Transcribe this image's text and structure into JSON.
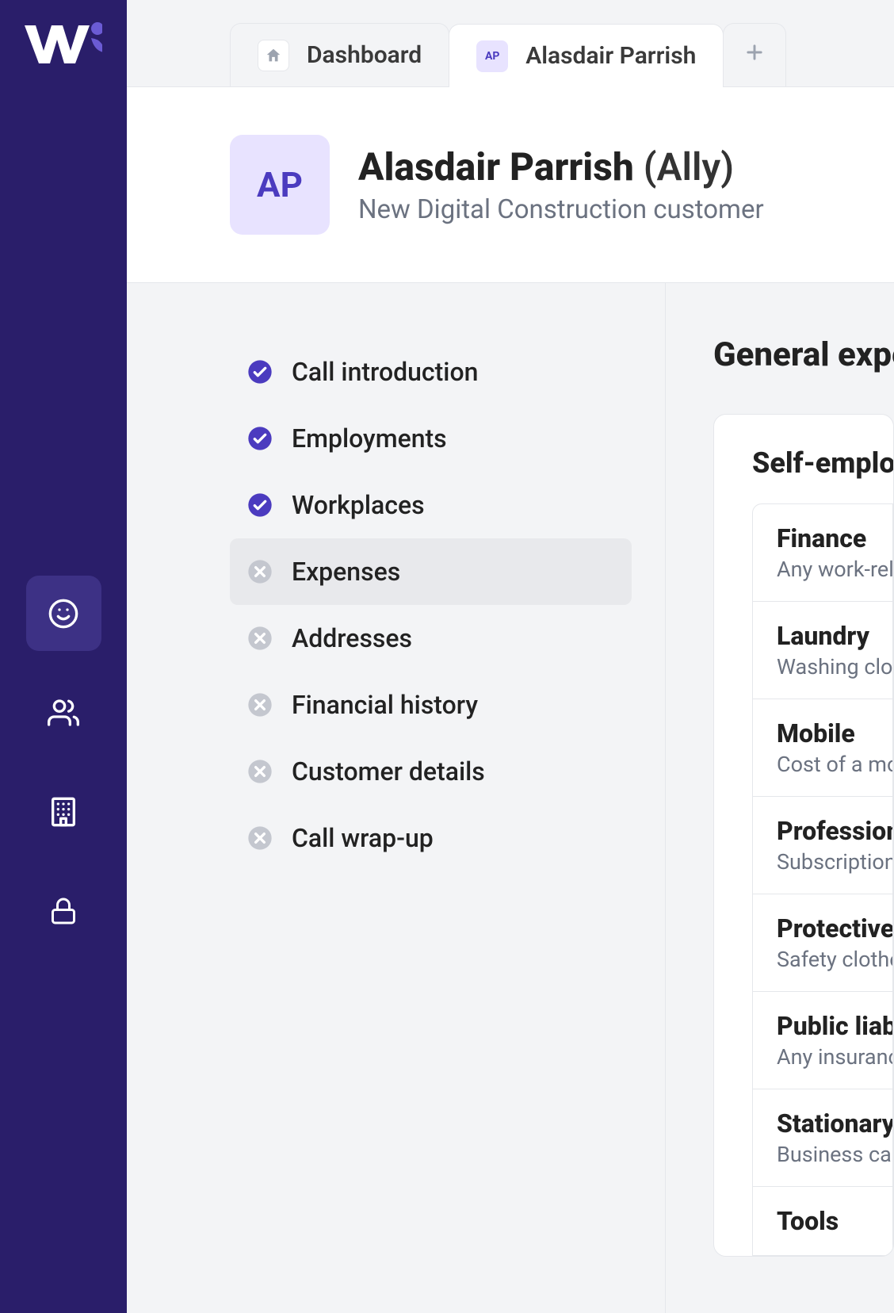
{
  "rail": {
    "items": [
      {
        "name": "smile",
        "active": true
      },
      {
        "name": "people",
        "active": false
      },
      {
        "name": "building",
        "active": false
      },
      {
        "name": "lock",
        "active": false
      }
    ]
  },
  "tabs": [
    {
      "kind": "home",
      "label": "Dashboard",
      "active": false
    },
    {
      "kind": "avatar",
      "label": "Alasdair Parrish",
      "initials": "AP",
      "active": true
    }
  ],
  "header": {
    "initials": "AP",
    "name": "Alasdair Parrish",
    "nickname": "(Ally)",
    "subtitle": "New Digital Construction customer"
  },
  "checklist": [
    {
      "label": "Call introduction",
      "done": true,
      "selected": false
    },
    {
      "label": "Employments",
      "done": true,
      "selected": false
    },
    {
      "label": "Workplaces",
      "done": true,
      "selected": false
    },
    {
      "label": "Expenses",
      "done": false,
      "selected": true
    },
    {
      "label": "Addresses",
      "done": false,
      "selected": false
    },
    {
      "label": "Financial history",
      "done": false,
      "selected": false
    },
    {
      "label": "Customer details",
      "done": false,
      "selected": false
    },
    {
      "label": "Call wrap-up",
      "done": false,
      "selected": false
    }
  ],
  "content": {
    "heading": "General expenses",
    "card_title": "Self-employed expenses",
    "expenses": [
      {
        "title": "Finance",
        "desc": "Any work-related finance costs"
      },
      {
        "title": "Laundry",
        "desc": "Washing clothes for work"
      },
      {
        "title": "Mobile",
        "desc": "Cost of a mobile phone"
      },
      {
        "title": "Professional",
        "desc": "Subscriptions and memberships"
      },
      {
        "title": "Protective",
        "desc": "Safety clothes and equipment"
      },
      {
        "title": "Public liability",
        "desc": "Any insurance for work"
      },
      {
        "title": "Stationary",
        "desc": "Business cards and paper"
      },
      {
        "title": "Tools",
        "desc": ""
      }
    ]
  }
}
